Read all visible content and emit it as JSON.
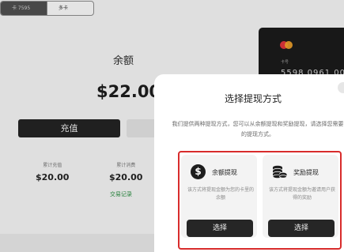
{
  "tabs": [
    {
      "label": "卡 7595",
      "active": true
    },
    {
      "label": "多卡",
      "active": false
    }
  ],
  "balance": {
    "title": "余额",
    "amount": "$22.00",
    "recharge_label": "充值"
  },
  "stats": [
    {
      "label": "累计充值",
      "value": "$20.00"
    },
    {
      "label": "累计消费",
      "value": "$20.00"
    }
  ],
  "records_link": "交易记录",
  "card": {
    "label": "卡号",
    "number": "5598 0961 00"
  },
  "modal": {
    "title": "选择提现方式",
    "description": "我们提供两种提现方式，您可以从余额提现和奖励提现，请选择您需要的提现方式。",
    "options": [
      {
        "icon": "dollar-coin-icon",
        "title": "余额提现",
        "description": "该方式将提现金额为您的卡里的余额",
        "button": "选择"
      },
      {
        "icon": "coin-stack-icon",
        "title": "奖励提现",
        "description": "该方式将提现金额为邀请用户获得的奖励",
        "button": "选择"
      }
    ]
  },
  "colors": {
    "highlight": "#d82c2c",
    "link": "#2a8a40",
    "dark_button": "#262626"
  }
}
